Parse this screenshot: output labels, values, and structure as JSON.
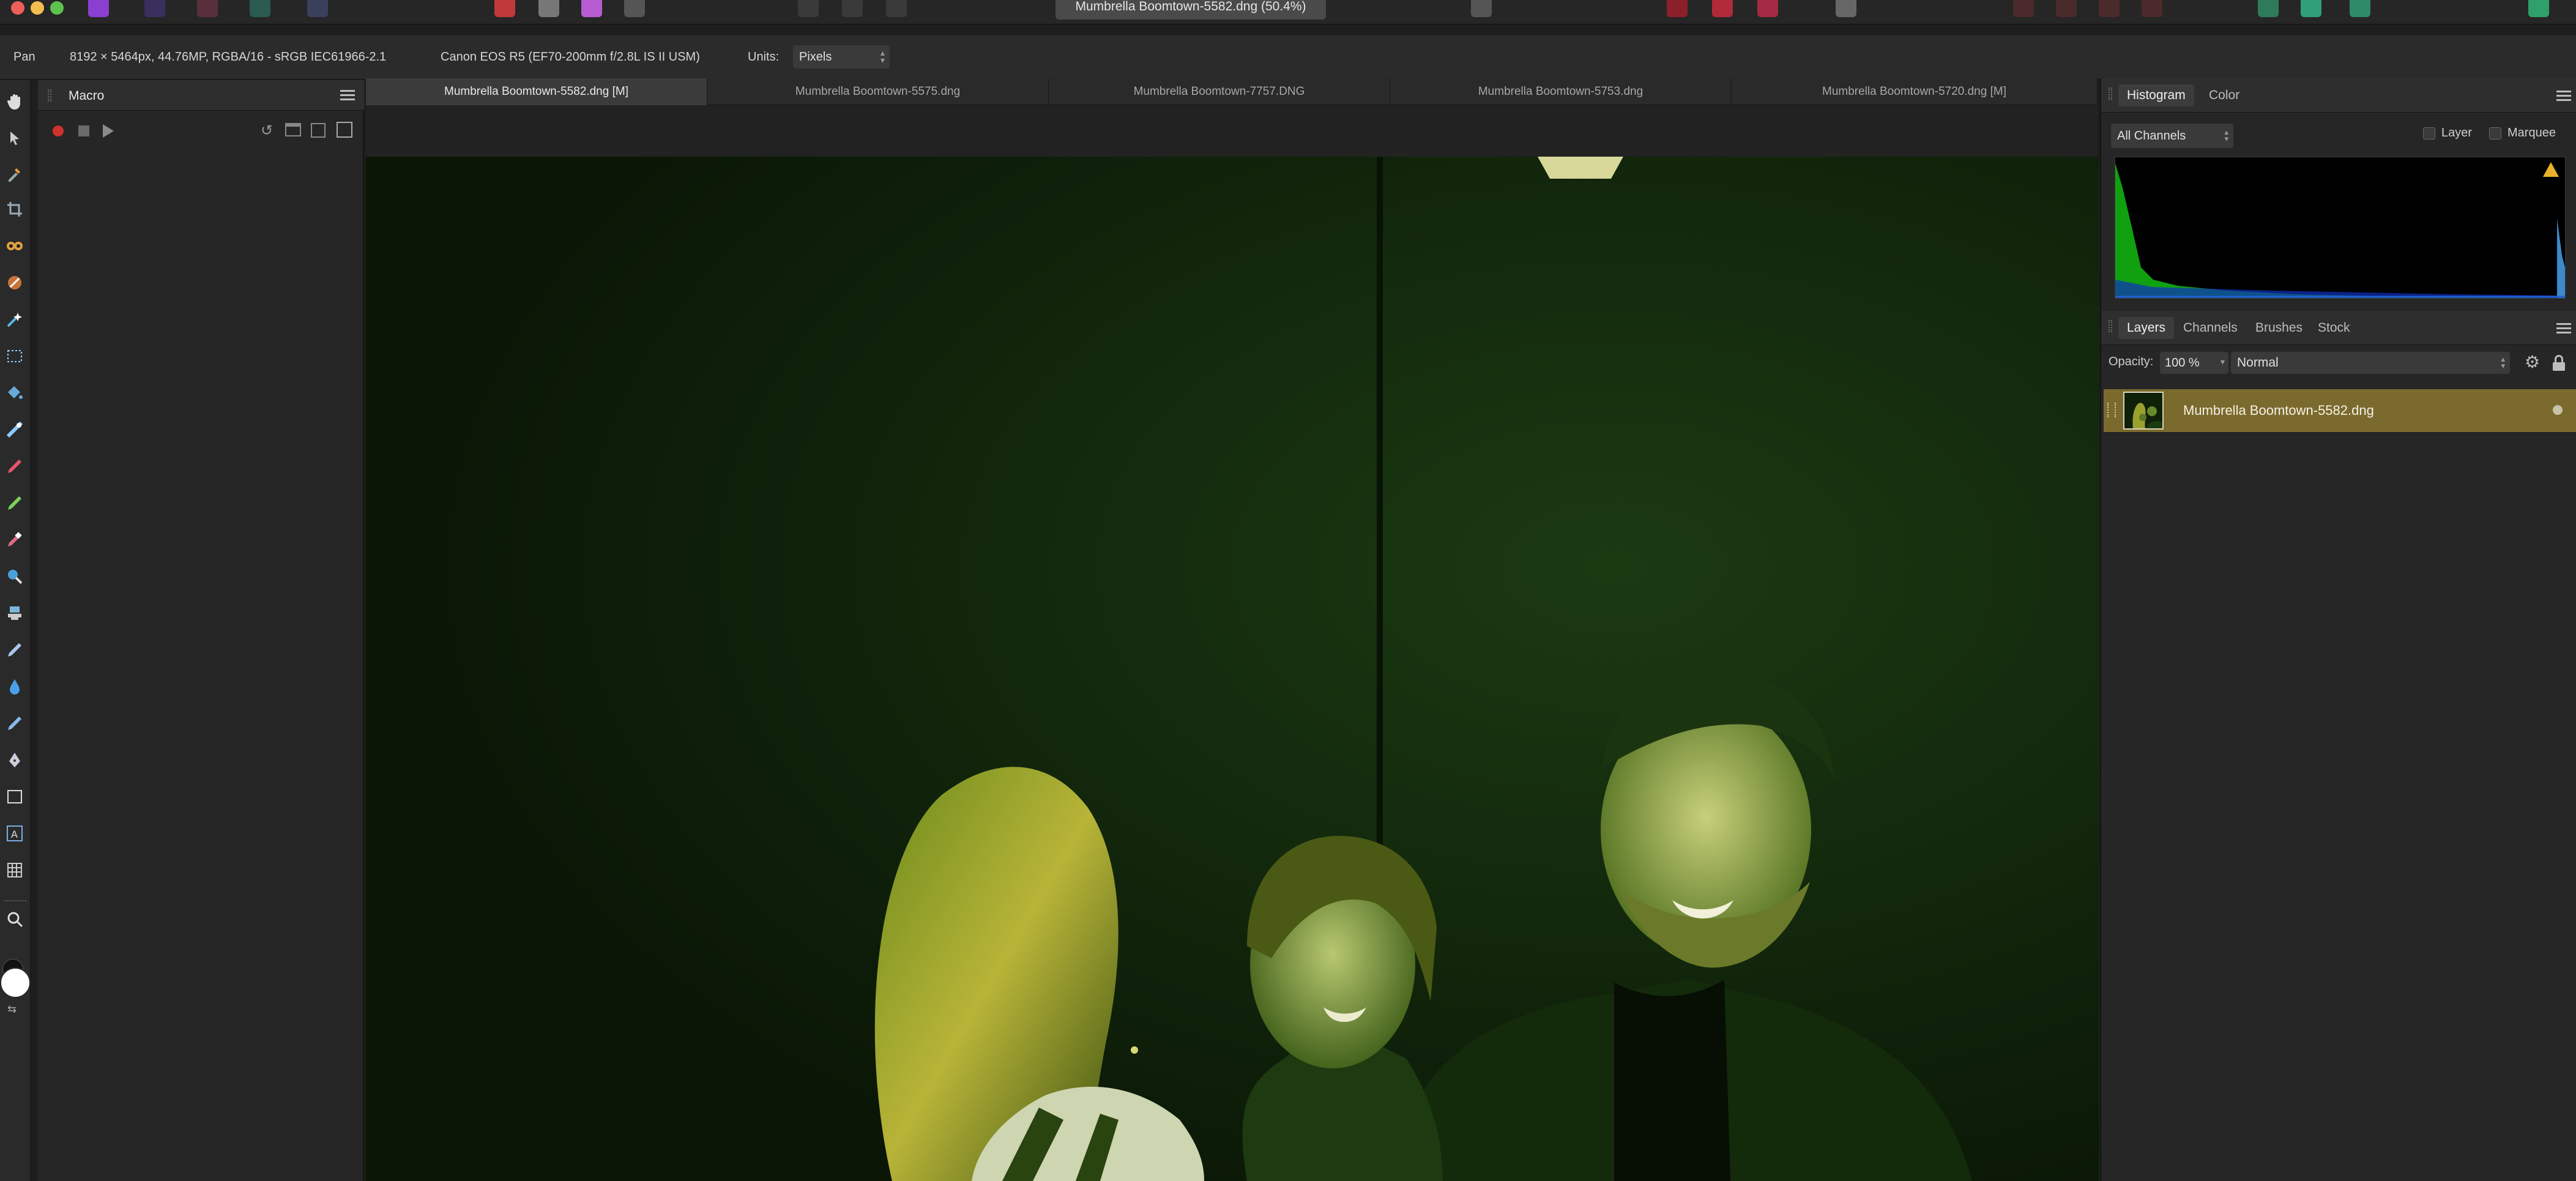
{
  "toolbar": {
    "document_title": "Mumbrella Boomtown-5582.dng (50.4%)"
  },
  "context_bar": {
    "tool_name": "Pan",
    "image_info": "8192 × 5464px, 44.76MP, RGBA/16 - sRGB IEC61966-2.1",
    "camera_info": "Canon EOS R5 (EF70-200mm f/2.8L IS II USM)",
    "units_label": "Units:",
    "units_value": "Pixels"
  },
  "macro_panel": {
    "title": "Macro"
  },
  "document_tabs": [
    {
      "label": "Mumbrella Boomtown-5582.dng [M]",
      "active": true
    },
    {
      "label": "Mumbrella Boomtown-5575.dng",
      "active": false
    },
    {
      "label": "Mumbrella Boomtown-7757.DNG",
      "active": false
    },
    {
      "label": "Mumbrella Boomtown-5753.dng",
      "active": false
    },
    {
      "label": "Mumbrella Boomtown-5720.dng [M]",
      "active": false
    }
  ],
  "histogram_panel": {
    "tabs": [
      "Histogram",
      "Color"
    ],
    "channel_select": "All Channels",
    "layer_checkbox": "Layer",
    "marquee_checkbox": "Marquee"
  },
  "layers_panel": {
    "tabs": [
      "Layers",
      "Channels",
      "Brushes",
      "Stock"
    ],
    "opacity_label": "Opacity:",
    "opacity_value": "100 %",
    "blend_mode": "Normal",
    "layers": [
      {
        "name": "Mumbrella Boomtown-5582.dng",
        "selected": true
      }
    ]
  },
  "colors": {
    "selected_layer": "#7b6a2d",
    "canvas_tint": "#0c1a07",
    "histogram_green": "#10a010",
    "record_red": "#d0312d"
  }
}
